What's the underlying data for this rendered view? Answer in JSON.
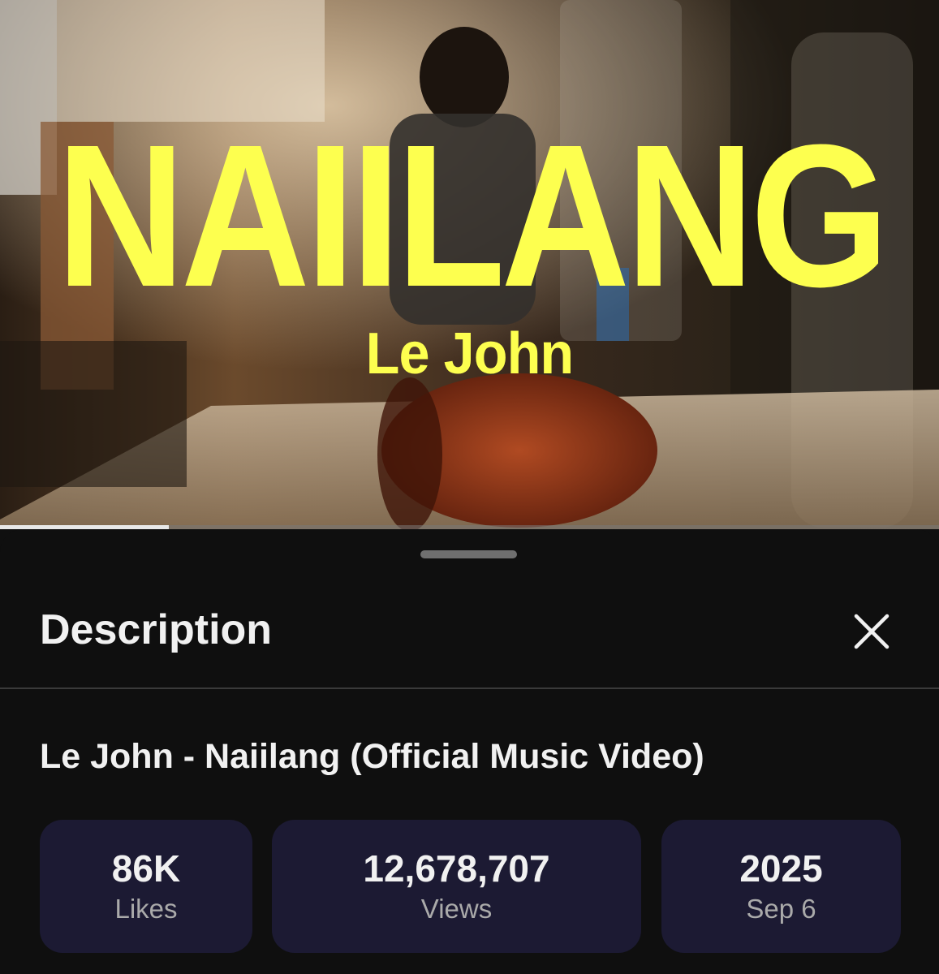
{
  "video": {
    "overlay_title": "NAIILANG",
    "overlay_artist": "Le John",
    "progress_fraction": 0.18,
    "title_color": "#fdff4f"
  },
  "sheet": {
    "title": "Description",
    "close_icon": "close-icon",
    "video_title": "Le John - Naiilang (Official Music Video)",
    "stats": [
      {
        "value": "86K",
        "label": "Likes"
      },
      {
        "value": "12,678,707",
        "label": "Views"
      },
      {
        "value": "2025",
        "label": "Sep 6"
      }
    ],
    "stat_card_color": "#1c1a33"
  }
}
